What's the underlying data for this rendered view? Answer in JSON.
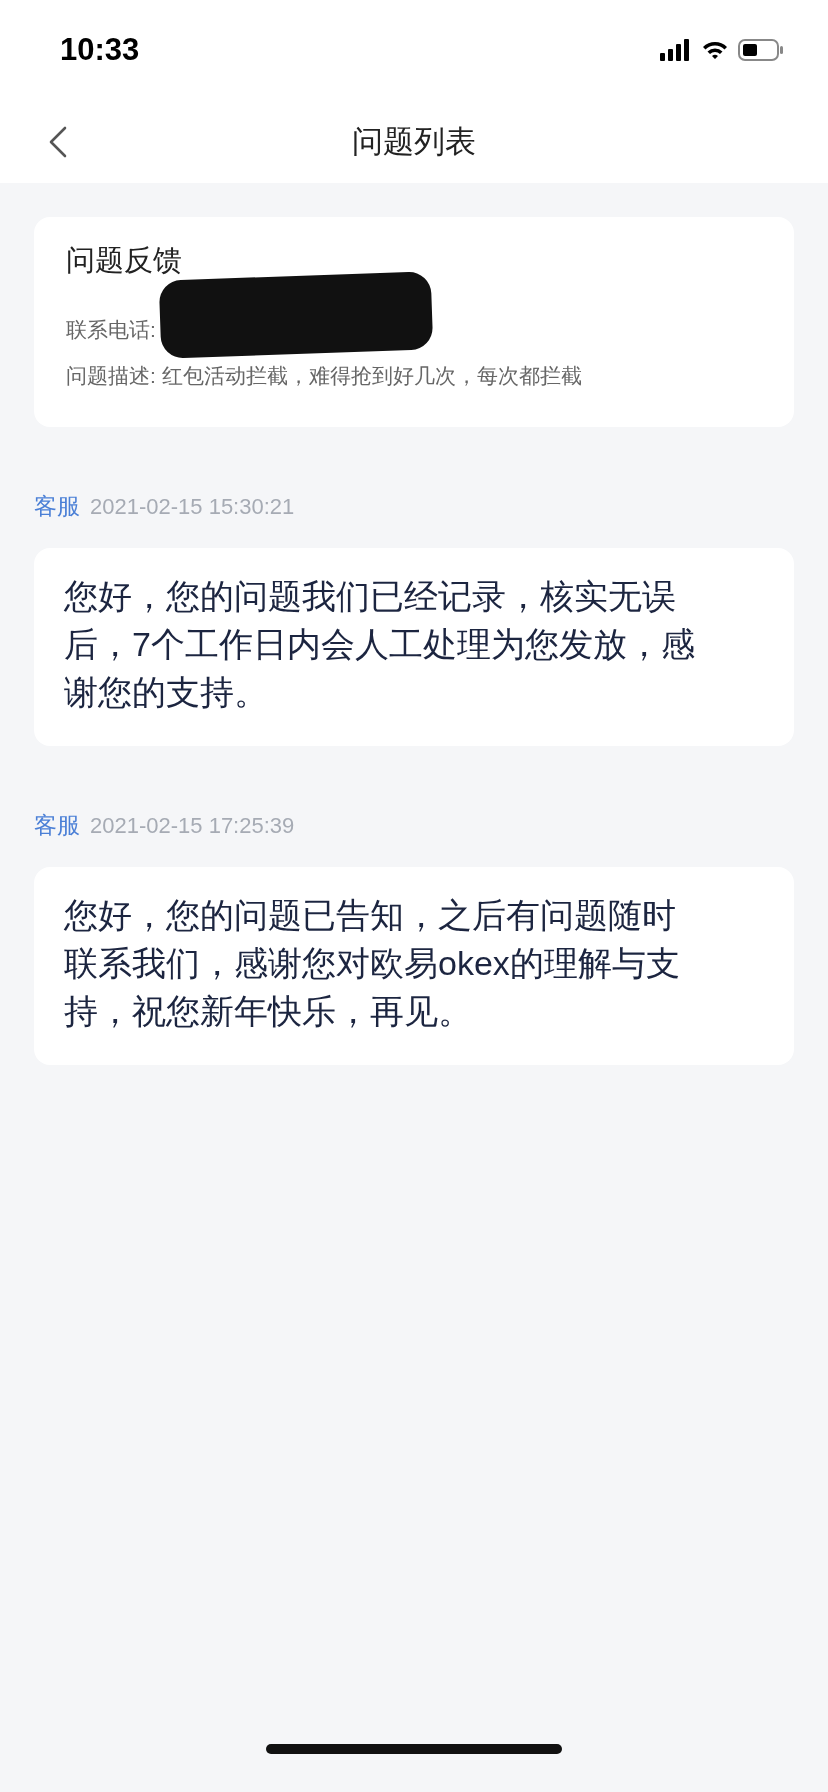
{
  "status_bar": {
    "time": "10:33"
  },
  "nav": {
    "title": "问题列表"
  },
  "feedback": {
    "title": "问题反馈",
    "phone_label": "联系电话:",
    "phone_redacted": true,
    "description": "问题描述: 红包活动拦截，难得抢到好几次，每次都拦截"
  },
  "replies": [
    {
      "sender": "客服",
      "time": "2021-02-15 15:30:21",
      "message": "您好，您的问题我们已经记录，核实无误后，7个工作日内会人工处理为您发放，感谢您的支持。"
    },
    {
      "sender": "客服",
      "time": "2021-02-15 17:25:39",
      "message": "您好，您的问题已告知，之后有问题随时联系我们，感谢您对欧易okex的理解与支持，祝您新年快乐，再见。"
    }
  ]
}
